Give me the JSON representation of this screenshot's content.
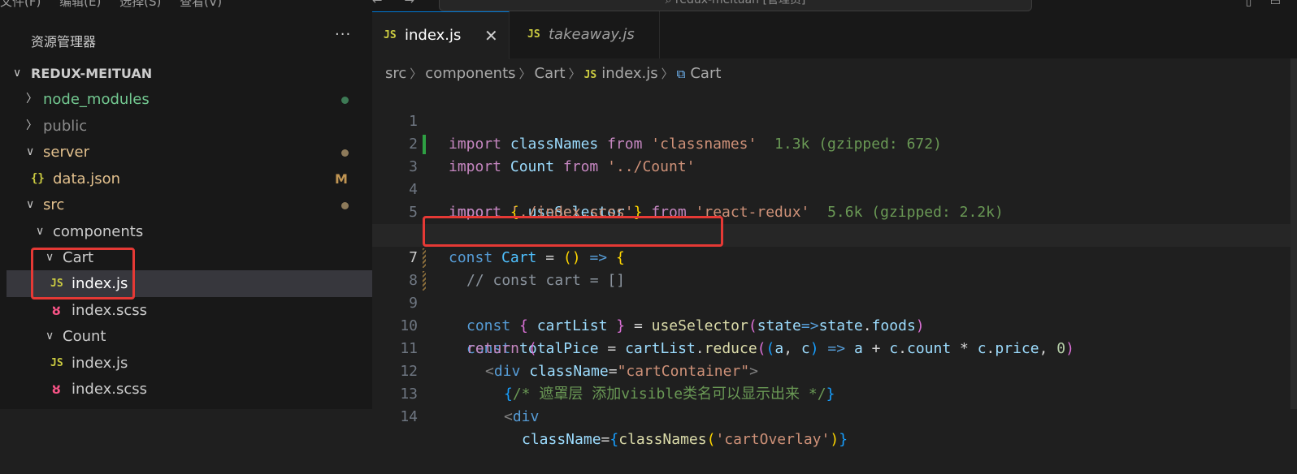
{
  "titlebar": {
    "menus": [
      "文件(F)",
      "编辑(E)",
      "选择(S)",
      "查看(V)"
    ],
    "nav_back": "←",
    "nav_forward": "→",
    "search": "redux-meituan [管理员]"
  },
  "sidebar": {
    "title": "资源管理器",
    "more": "···",
    "root": "REDUX-MEITUAN",
    "items": [
      {
        "label": "node_modules",
        "color": "#73c991",
        "status_dot": "#3d7a55"
      },
      {
        "label": "public",
        "color": "#8b8b8b"
      },
      {
        "label": "server",
        "color": "#e2c08d",
        "status_dot": "#8d7a5a"
      },
      {
        "label": "data.json",
        "icon": "{}",
        "color": "#e2c08d",
        "badge": "M"
      },
      {
        "label": "src",
        "color": "#e2c08d",
        "status_dot": "#8d7a5a"
      },
      {
        "label": "components",
        "color": "#cccccc"
      },
      {
        "label": "Cart",
        "color": "#cccccc"
      },
      {
        "label": "index.js",
        "icon": "JS",
        "color": "#ffffff"
      },
      {
        "label": "index.scss",
        "icon": "scss-icon",
        "color": "#cccccc"
      },
      {
        "label": "Count",
        "color": "#cccccc"
      },
      {
        "label": "index.js",
        "icon": "JS",
        "color": "#cccccc"
      },
      {
        "label": "index.scss",
        "icon": "scss-icon",
        "color": "#cccccc"
      }
    ]
  },
  "tabs": [
    {
      "icon": "JS",
      "label": "index.js",
      "active": true,
      "close": "✕"
    },
    {
      "icon": "JS",
      "label": "takeaway.js",
      "active": false
    }
  ],
  "breadcrumb": {
    "parts": [
      "src",
      "components",
      "Cart",
      "index.js",
      "Cart"
    ],
    "file_icon": "JS",
    "symbol_icon": "⧉"
  },
  "code": {
    "line_numbers": [
      "1",
      "2",
      "3",
      "4",
      "5",
      "6",
      "7",
      "8",
      "9",
      "10",
      "11",
      "12",
      "13",
      "14"
    ],
    "current_line": 7,
    "import_cost_1": "1.3k (gzipped: 672)",
    "import_cost_3": "5.6k (gzipped: 2.2k)",
    "comment_12": "/* 遮罩层 添加visible类名可以显示出来 */"
  },
  "colors": {
    "highlight_box": "#e53935",
    "sidebar_bg": "#181818",
    "editor_bg": "#1f1f1f",
    "active_tab_border": "#0078d4"
  }
}
